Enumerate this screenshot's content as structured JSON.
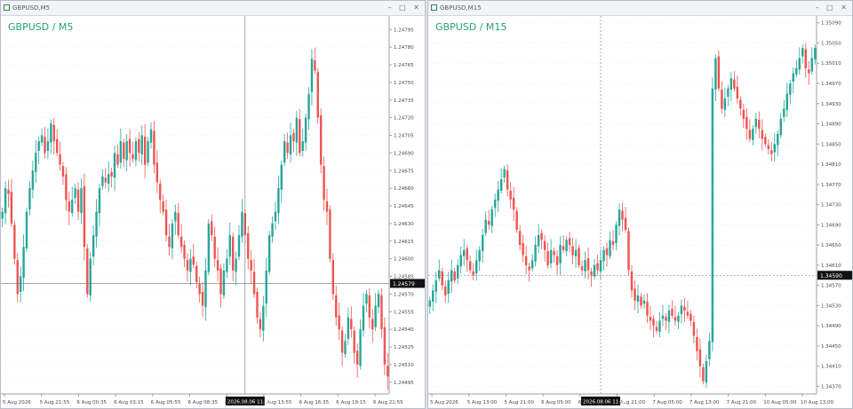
{
  "colors": {
    "bull": "#26a69a",
    "bear": "#ef5350",
    "accent": "#26a269",
    "grid": "#e6e8ec",
    "crosshair": "#6b7280",
    "price_tag_bg": "#111111",
    "price_tag_fg": "#ffffff"
  },
  "windows": [
    {
      "title": "GBPUSD,M5",
      "symbol_label": "GBPUSD / M5",
      "buttons": "– □ ✕",
      "chart_data": {
        "type": "candlestick",
        "y_ticks": [
          "1.24795",
          "1.24780",
          "1.24765",
          "1.24750",
          "1.24735",
          "1.24720",
          "1.24705",
          "1.24690",
          "1.24675",
          "1.24660",
          "1.24645",
          "1.24630",
          "1.24615",
          "1.24600",
          "1.24585",
          "1.24570",
          "1.24555",
          "1.24540",
          "1.24525",
          "1.24510",
          "1.24495"
        ],
        "x_ticks": [
          "5 Aug 2026",
          "5 Aug 21:55",
          "6 Aug 00:35",
          "6 Aug 03:15",
          "6 Aug 05:55",
          "6 Aug 08:35",
          "6 Aug 11:15",
          "6 Aug 13:55",
          "6 Aug 16:35",
          "6 Aug 19:15",
          "6 Aug 21:55"
        ],
        "ylim": [
          1.24485,
          1.24805
        ],
        "crosshair_price": "1.24579",
        "crosshair_time": "2026.08.06 11:30",
        "crosshair_y": 1.24579,
        "crosshair_x_index": 80,
        "closes": [
          1.2464,
          1.2466,
          1.24655,
          1.2463,
          1.246,
          1.2457,
          1.24585,
          1.2461,
          1.2464,
          1.2466,
          1.24675,
          1.2469,
          1.247,
          1.24705,
          1.2469,
          1.247,
          1.24715,
          1.247,
          1.2469,
          1.2468,
          1.2467,
          1.2465,
          1.2464,
          1.2465,
          1.2466,
          1.2464,
          1.2466,
          1.2461,
          1.2457,
          1.246,
          1.2462,
          1.2464,
          1.2466,
          1.2467,
          1.24665,
          1.24672,
          1.2467,
          1.2469,
          1.2468,
          1.247,
          1.24685,
          1.247,
          1.2469,
          1.24685,
          1.247,
          1.2469,
          1.24705,
          1.2468,
          1.247,
          1.2471,
          1.2468,
          1.24665,
          1.2465,
          1.2464,
          1.2462,
          1.2461,
          1.2463,
          1.2464,
          1.2462,
          1.2461,
          1.246,
          1.2459,
          1.246,
          1.24595,
          1.2458,
          1.2457,
          1.2456,
          1.2459,
          1.2463,
          1.2462,
          1.246,
          1.2459,
          1.2457,
          1.2459,
          1.246,
          1.2462,
          1.2459,
          1.246,
          1.2462,
          1.2464,
          1.2462,
          1.246,
          1.2459,
          1.2457,
          1.2455,
          1.2454,
          1.2456,
          1.2459,
          1.2462,
          1.2463,
          1.2464,
          1.2466,
          1.2468,
          1.247,
          1.2469,
          1.24705,
          1.247,
          1.2472,
          1.2469,
          1.247,
          1.2472,
          1.2474,
          1.2477,
          1.2476,
          1.2472,
          1.2468,
          1.2465,
          1.2464,
          1.246,
          1.2457,
          1.2455,
          1.2454,
          1.2452,
          1.2453,
          1.2455,
          1.2454,
          1.2452,
          1.2451,
          1.2454,
          1.2456,
          1.2457,
          1.2455,
          1.2454,
          1.2456,
          1.2457,
          1.2454,
          1.2451,
          1.245
        ],
        "opens_offset": 6e-05
      }
    },
    {
      "title": "GBPUSD,M15",
      "symbol_label": "GBPUSD / M15",
      "buttons": "– □ ✕",
      "chart_data": {
        "type": "candlestick",
        "y_ticks": [
          "1.35090",
          "1.35050",
          "1.35010",
          "1.34970",
          "1.34930",
          "1.34890",
          "1.34850",
          "1.34810",
          "1.34770",
          "1.34730",
          "1.34690",
          "1.34650",
          "1.34610",
          "1.34570",
          "1.34530",
          "1.34490",
          "1.34450",
          "1.34410",
          "1.34370"
        ],
        "x_ticks": [
          "5 Aug 2026",
          "5 Aug 13:00",
          "5 Aug 21:00",
          "6 Aug 05:00",
          "6 Aug 13:00",
          "6 Aug 21:00",
          "7 Aug 05:00",
          "7 Aug 13:00",
          "7 Aug 21:00",
          "10 Aug 05:00",
          "10 Aug 13:00"
        ],
        "ylim": [
          1.34355,
          1.351
        ],
        "crosshair_price": "1.34590",
        "crosshair_time": "2026.08.06 11:00",
        "crosshair_y": 1.3459,
        "crosshair_x_index": 55,
        "closes": [
          1.3454,
          1.3456,
          1.3458,
          1.346,
          1.3457,
          1.3455,
          1.3458,
          1.346,
          1.3458,
          1.3461,
          1.3463,
          1.3464,
          1.3462,
          1.346,
          1.3459,
          1.3462,
          1.3464,
          1.3467,
          1.347,
          1.3469,
          1.3472,
          1.3474,
          1.3476,
          1.3478,
          1.348,
          1.3476,
          1.3474,
          1.3472,
          1.3468,
          1.3465,
          1.3463,
          1.3461,
          1.346,
          1.3462,
          1.3465,
          1.3467,
          1.3466,
          1.3464,
          1.3461,
          1.3464,
          1.3463,
          1.3461,
          1.3465,
          1.3464,
          1.3466,
          1.3465,
          1.3463,
          1.3464,
          1.3461,
          1.346,
          1.3462,
          1.346,
          1.3459,
          1.3461,
          1.346,
          1.3462,
          1.3464,
          1.3463,
          1.3466,
          1.3465,
          1.3469,
          1.3472,
          1.347,
          1.3468,
          1.346,
          1.3456,
          1.3454,
          1.3455,
          1.3453,
          1.3454,
          1.3451,
          1.345,
          1.3449,
          1.3448,
          1.345,
          1.3451,
          1.345,
          1.3452,
          1.3451,
          1.345,
          1.3451,
          1.3453,
          1.3452,
          1.3451,
          1.345,
          1.3447,
          1.3444,
          1.3441,
          1.3438,
          1.3442,
          1.3446,
          1.3496,
          1.3502,
          1.3496,
          1.3492,
          1.3494,
          1.3496,
          1.3498,
          1.3496,
          1.3494,
          1.3492,
          1.349,
          1.3488,
          1.3486,
          1.3488,
          1.349,
          1.3488,
          1.3486,
          1.3485,
          1.3484,
          1.3483,
          1.3485,
          1.3487,
          1.349,
          1.3492,
          1.3495,
          1.3497,
          1.3499,
          1.35,
          1.3502,
          1.3504,
          1.35,
          1.3499,
          1.3502,
          1.3504
        ],
        "opens_offset": 0.00012
      }
    }
  ]
}
